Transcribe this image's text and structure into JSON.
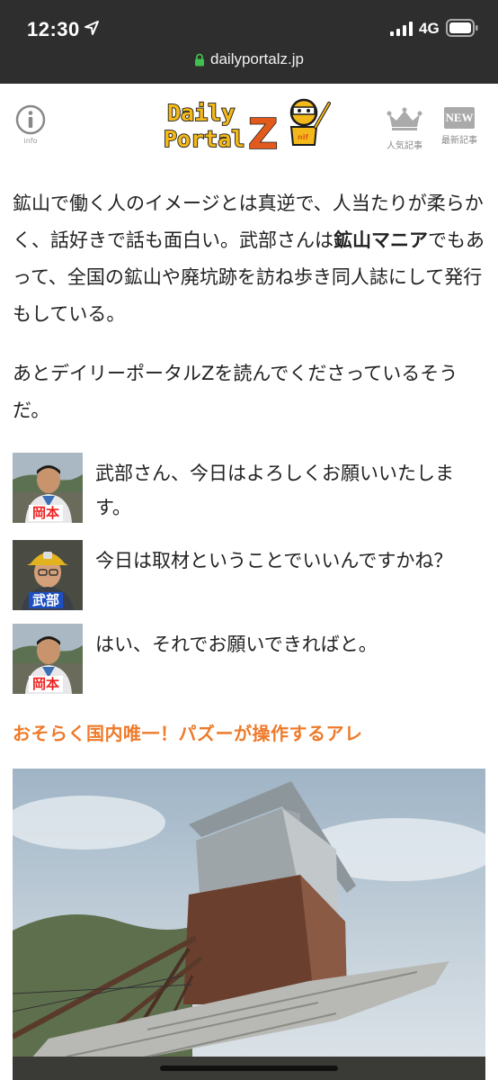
{
  "status_bar": {
    "time": "12:30",
    "network": "4G"
  },
  "browser": {
    "url": "dailyportalz.jp"
  },
  "header": {
    "info_label": "info",
    "logo_line1": "Daily",
    "logo_line2": "Portal",
    "logo_z": "Z",
    "ranking_label": "人気記事",
    "new_badge": "NEW",
    "new_label": "最新記事"
  },
  "article": {
    "paragraph1_part1": "鉱山で働く人のイメージとは真逆で、人当たりが柔らかく、話好きで話も面白い。武部さんは",
    "paragraph1_bold": "鉱山マニア",
    "paragraph1_part2": "でもあって、全国の鉱山や廃坑跡を訪ね歩き同人誌にして発行もしている。",
    "paragraph2": "あとデイリーポータルZを読んでくださっているそうだ。",
    "dialogue": [
      {
        "speaker": "岡本",
        "text": "武部さん、今日はよろしくお願いいたします。"
      },
      {
        "speaker": "武部",
        "text": "今日は取材ということでいいんですかね？"
      },
      {
        "speaker": "岡本",
        "text": "はい、それでお願いできればと。"
      }
    ],
    "section_heading": "おそらく国内唯一！パズーが操作するアレ"
  },
  "colors": {
    "accent_orange": "#ee7a2a",
    "browser_bar": "#2e2e2e",
    "speaker_red": "#e22222",
    "speaker_blue": "#1d4fc4"
  },
  "icons": {
    "location": "location-arrow-icon",
    "signal": "cell-signal-icon",
    "battery": "battery-icon",
    "lock": "lock-icon",
    "info": "info-icon",
    "ranking": "crown-icon"
  }
}
